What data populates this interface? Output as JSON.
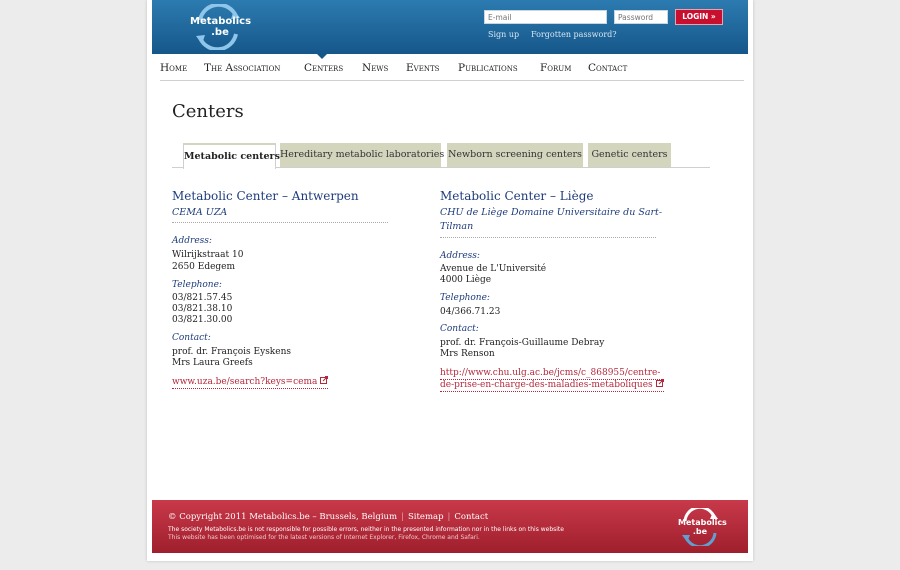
{
  "header": {
    "logo_line1": "Metabolics",
    "logo_line2": ".be",
    "email_placeholder": "E-mail",
    "password_placeholder": "Password",
    "login_label": "LOGIN »",
    "signup_label": "Sign up",
    "forgot_label": "Forgotten password?"
  },
  "nav": [
    "Home",
    "The Association",
    "Centers",
    "News",
    "Events",
    "Publications",
    "Forum",
    "Contact"
  ],
  "page_title": "Centers",
  "tabs": [
    "Metabolic centers",
    "Hereditary metabolic laboratories",
    "Newborn screening centers",
    "Genetic centers"
  ],
  "centers": [
    {
      "title": "Metabolic Center – Antwerpen",
      "org": "CEMA UZA",
      "address_label": "Address:",
      "address": [
        "Wilrijkstraat 10",
        "2650 Edegem"
      ],
      "telephone_label": "Telephone:",
      "telephone": [
        "03/821.57.45",
        "03/821.38.10",
        "03/821.30.00"
      ],
      "contact_label": "Contact:",
      "contact": [
        "prof. dr. François Eyskens",
        "Mrs Laura Greefs"
      ],
      "link": "www.uza.be/search?keys=cema"
    },
    {
      "title": "Metabolic Center – Liège",
      "org_lines": [
        "CHU de Liège Domaine Universitaire du Sart-",
        "Tilman"
      ],
      "address_label": "Address:",
      "address": [
        "Avenue de L'Université",
        "4000 Liège"
      ],
      "telephone_label": "Telephone:",
      "telephone": [
        "04/366.71.23"
      ],
      "contact_label": "Contact:",
      "contact": [
        "prof. dr. François-Guillaume Debray",
        "Mrs Renson"
      ],
      "link_lines": [
        "http://www.chu.ulg.ac.be/jcms/c_868955/centre-",
        "de-prise-en-charge-des-maladies-metaboliques"
      ]
    }
  ],
  "footer": {
    "copyright": "© Copyright 2011 Metabolics.be – Brussels, Belgium",
    "sitemap": "Sitemap",
    "contact": "Contact",
    "note1": "The society Metabolics.be is not responsible for possible errors, neither in the presented information nor in the links on this website",
    "note2": "This website has been optimised for the latest versions of Internet Explorer, Firefox, Chrome and Safari.",
    "logo_line1": "Metabolics",
    "logo_line2": ".be"
  },
  "colors": {
    "header_blue": "#1b659a",
    "nav_accent": "#1e3c7c",
    "login_red": "#c8102e",
    "footer_red": "#b52e3c",
    "tab_bg": "#d3d5bd",
    "link_red": "#b4283c"
  }
}
